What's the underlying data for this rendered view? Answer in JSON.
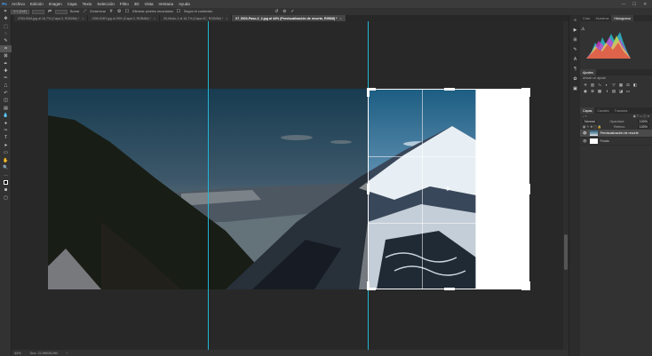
{
  "app": {
    "logo": "Ps"
  },
  "menu": [
    "Archivo",
    "Edición",
    "Imagen",
    "Capa",
    "Texto",
    "Selección",
    "Filtro",
    "3D",
    "Vista",
    "Ventana",
    "Ayuda"
  ],
  "window_controls": [
    "—",
    "☐",
    "✕"
  ],
  "options": {
    "ratio_select": "1:1 (1x1)",
    "value_a": "",
    "value_b": "",
    "clear": "Borrar",
    "straighten": "Enderezar",
    "delete_pixels": "Eliminar píxeles recortados",
    "content_aware": "Según el contenido"
  },
  "tabs": [
    {
      "label": "ZSKUSA5.jpg al 16,7% (Capa 0, RGB/8#) *"
    },
    {
      "label": "ZSKUS4R.jpg al 25% (Capa 0, RGB/8#) *"
    },
    {
      "label": "05-Modo-1 al 16,7% (Capa 0C, RGB/8#) *"
    },
    {
      "label": "07_BG0-Paso-2_2.jpg al 44% (Previsualización de recorte, RGB/8) *",
      "active": true
    }
  ],
  "status": {
    "zoom": "44%",
    "doc": "Doc: 22,9M/26,9M"
  },
  "panels": {
    "top_tabs": [
      "Color",
      "Muestras",
      "Histograma"
    ],
    "adjust_tabs": [
      "Ajustes"
    ],
    "adjust_add": "Añadir un ajuste",
    "layers_tabs": [
      "Capas",
      "Canales",
      "Trazados"
    ],
    "blend": "Normal",
    "opacity_label": "Opacidad:",
    "opacity": "100%",
    "fill_label": "Relleno:",
    "fill": "100%",
    "layers": [
      {
        "name": "Previsualización de recorte",
        "selected": true
      },
      {
        "name": "Fondo",
        "selected": false
      }
    ]
  },
  "colors": {
    "guide": "#22b6d4",
    "accent": "#4aa3ff"
  }
}
